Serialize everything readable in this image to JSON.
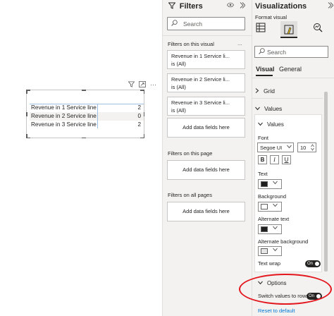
{
  "visual": {
    "header_icons": [
      "filter-icon",
      "focus-mode-icon",
      "more-options-icon"
    ],
    "more": "⋯",
    "rows": [
      {
        "name": "Revenue in 1 Service line",
        "value": "2"
      },
      {
        "name": "Revenue in 2 Service line",
        "value": "0"
      },
      {
        "name": "Revenue in 3 Service line",
        "value": "2"
      }
    ]
  },
  "filters": {
    "title": "Filters",
    "search_placeholder": "Search",
    "on_visual_label": "Filters on this visual",
    "more": "...",
    "cards": [
      {
        "line1": "Revenue in 1 Service li...",
        "line2": "is (All)"
      },
      {
        "line1": "Revenue in 2 Service li...",
        "line2": "is (All)"
      },
      {
        "line1": "Revenue in 3 Service li...",
        "line2": "is (All)"
      }
    ],
    "add_data_fields": "Add data fields here",
    "on_page_label": "Filters on this page",
    "on_all_pages_label": "Filters on all pages"
  },
  "visualizations": {
    "title": "Visualizations",
    "format_visual_label": "Format visual",
    "search_placeholder": "Search",
    "tabs": [
      "Visual",
      "General"
    ],
    "grid_label": "Grid",
    "values_section_label": "Values",
    "values_card_label": "Values",
    "font_label": "Font",
    "font_family": "Segoe UI",
    "font_size": "10",
    "bold": "B",
    "italic": "I",
    "underline": "U",
    "text_label": "Text",
    "text_color": "#1f1f1f",
    "background_label": "Background",
    "background_color": "#ffffff",
    "alt_text_label": "Alternate text",
    "alt_text_color": "#1f1f1f",
    "alt_bg_label": "Alternate background",
    "alt_bg_color": "#e6e6e6",
    "text_wrap_label": "Text wrap",
    "text_wrap_state": "On",
    "options_label": "Options",
    "switch_values_label": "Switch values to rows",
    "switch_values_state": "On",
    "reset_label": "Reset to default",
    "highlight_color": "#e3171d"
  }
}
